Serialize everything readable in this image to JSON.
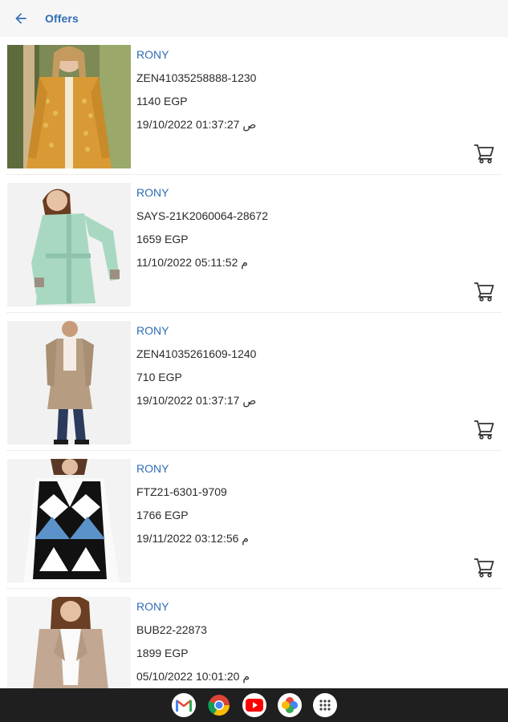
{
  "header": {
    "title": "Offers",
    "back_icon": "arrow-back-icon",
    "background": "#f6f6f6",
    "accent": "#2f6db5"
  },
  "items": [
    {
      "brand": "RONY",
      "code": "ZEN41035258888-1230",
      "price": "1140 EGP",
      "date": "ص 01:37:27 19/10/2022",
      "image": "mustard-cardigan-photo",
      "cart_icon": "cart-icon"
    },
    {
      "brand": "RONY",
      "code": "SAYS-21K2060064-28672",
      "price": "1659 EGP",
      "date": "م 05:11:52 11/10/2022",
      "image": "mint-jacket-photo",
      "cart_icon": "cart-icon"
    },
    {
      "brand": "RONY",
      "code": "ZEN41035261609-1240",
      "price": "710 EGP",
      "date": "ص 01:37:17 19/10/2022",
      "image": "beige-cardigan-photo",
      "cart_icon": "cart-icon"
    },
    {
      "brand": "RONY",
      "code": "FTZ21-6301-9709",
      "price": "1766 EGP",
      "date": "م 03:12:56 19/11/2022",
      "image": "argyle-vest-photo",
      "cart_icon": "cart-icon"
    },
    {
      "brand": "RONY",
      "code": "BUB22-22873",
      "price": "1899 EGP",
      "date": "م 10:01:20 05/10/2022",
      "image": "taupe-blazer-photo",
      "cart_icon": "cart-icon"
    }
  ],
  "dock": {
    "apps": [
      "gmail-icon",
      "chrome-icon",
      "youtube-icon",
      "photos-icon",
      "app-drawer-icon"
    ],
    "background": "#1f1f1f"
  }
}
